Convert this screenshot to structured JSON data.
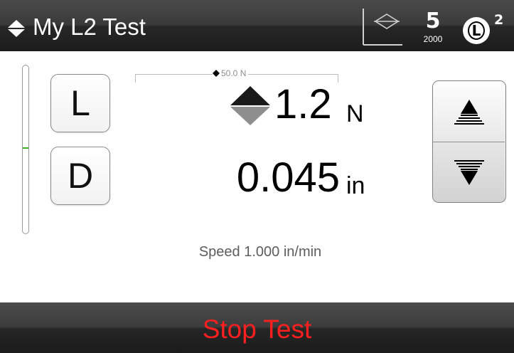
{
  "header": {
    "title_icon": "up-down-diamond-icon",
    "title": "My L2 Test",
    "chart_icon": "graph-axes-icon",
    "speed_icon": "speed-setting-icon",
    "speed_digit": "5",
    "speed_value": "2000",
    "mode_icon": "load-mode-icon",
    "mode_letter": "L",
    "mode_superscript": "2"
  },
  "gauge": {
    "position_fraction": 0.49,
    "marker_color": "#43b02a"
  },
  "buttons": {
    "load": "L",
    "displacement": "D"
  },
  "readouts": {
    "limit_label": "50.0 N",
    "load_value": "1.2",
    "load_unit": "N",
    "displacement_value": "0.045",
    "displacement_unit": "in",
    "speed": "Speed 1.000 in/min"
  },
  "jog": {
    "up_icon": "jog-up-arrow-icon",
    "down_icon": "jog-down-arrow-icon"
  },
  "footer": {
    "stop_label": "Stop Test",
    "stop_color": "#ff1f1f"
  }
}
